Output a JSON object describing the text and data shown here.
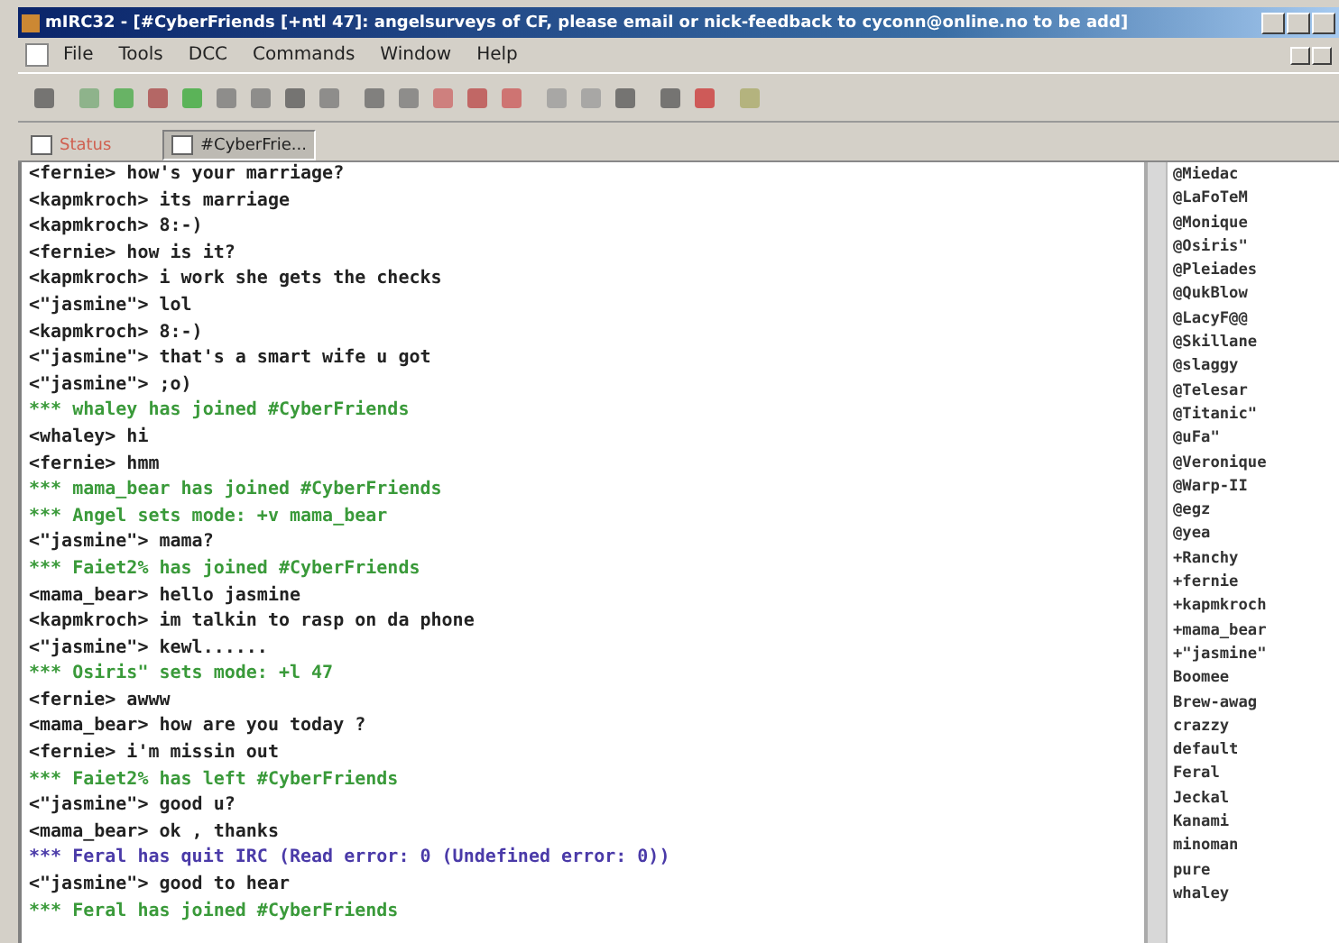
{
  "window": {
    "title": "mIRC32 - [#CyberFriends [+ntl 47]: angelsurveys of CF, please email or nick-feedback to cyconn@online.no to be add]"
  },
  "menu": [
    "File",
    "Tools",
    "DCC",
    "Commands",
    "Window",
    "Help"
  ],
  "tabs": [
    {
      "label": "Status",
      "selected": false
    },
    {
      "label": "#CyberFrie...",
      "selected": true
    }
  ],
  "chat": [
    {
      "kind": "msg",
      "text": "<fernie> how's your marriage?"
    },
    {
      "kind": "msg",
      "text": "<kapmkroch> its marriage"
    },
    {
      "kind": "msg",
      "text": "<kapmkroch> 8:-)"
    },
    {
      "kind": "msg",
      "text": "<fernie> how is it?"
    },
    {
      "kind": "msg",
      "text": "<kapmkroch> i work she gets the checks"
    },
    {
      "kind": "msg",
      "text": "<\"jasmine\"> lol"
    },
    {
      "kind": "msg",
      "text": "<kapmkroch> 8:-)"
    },
    {
      "kind": "msg",
      "text": "<\"jasmine\"> that's a smart wife u got"
    },
    {
      "kind": "msg",
      "text": "<\"jasmine\"> ;o)"
    },
    {
      "kind": "event",
      "text": "*** whaley has joined #CyberFriends"
    },
    {
      "kind": "msg",
      "text": "<whaley> hi"
    },
    {
      "kind": "msg",
      "text": "<fernie> hmm"
    },
    {
      "kind": "event",
      "text": "*** mama_bear has joined #CyberFriends"
    },
    {
      "kind": "event",
      "text": "*** Angel sets mode: +v mama_bear"
    },
    {
      "kind": "msg",
      "text": "<\"jasmine\"> mama?"
    },
    {
      "kind": "event",
      "text": "*** Faiet2% has joined #CyberFriends"
    },
    {
      "kind": "msg",
      "text": "<mama_bear> hello jasmine"
    },
    {
      "kind": "msg",
      "text": "<kapmkroch> im talkin to rasp on da phone"
    },
    {
      "kind": "msg",
      "text": "<\"jasmine\"> kewl......"
    },
    {
      "kind": "event",
      "text": "*** Osiris\" sets mode: +l 47"
    },
    {
      "kind": "msg",
      "text": "<fernie> awww"
    },
    {
      "kind": "msg",
      "text": "<mama_bear> how are you today ?"
    },
    {
      "kind": "msg",
      "text": "<fernie> i'm missin out"
    },
    {
      "kind": "event",
      "text": "*** Faiet2% has left #CyberFriends"
    },
    {
      "kind": "msg",
      "text": "<\"jasmine\"> good u?"
    },
    {
      "kind": "msg",
      "text": "<mama_bear> ok , thanks"
    },
    {
      "kind": "quit",
      "text": "*** Feral has quit IRC (Read error: 0 (Undefined error: 0))"
    },
    {
      "kind": "msg",
      "text": "<\"jasmine\"> good to hear"
    },
    {
      "kind": "event",
      "text": "*** Feral has joined #CyberFriends"
    }
  ],
  "nicklist": [
    "@Miedac",
    "@LaFoTeM",
    "@Monique",
    "@Osiris\"",
    "@Pleiades",
    "@QukBlow",
    "@LacyF@@",
    "@Skillane",
    "@slaggy",
    "@Telesar",
    "@Titanic\"",
    "@uFa\"",
    "@Veronique",
    "@Warp-II",
    "@egz",
    "@yea",
    "+Ranchy",
    "+fernie",
    "+kapmkroch",
    "+mama_bear",
    "+\"jasmine\"",
    "Boomee",
    "Brew-awag",
    "crazzy",
    "default",
    "Feral",
    "Jeckal",
    "Kanami",
    "minoman",
    "pure",
    "whaley"
  ]
}
